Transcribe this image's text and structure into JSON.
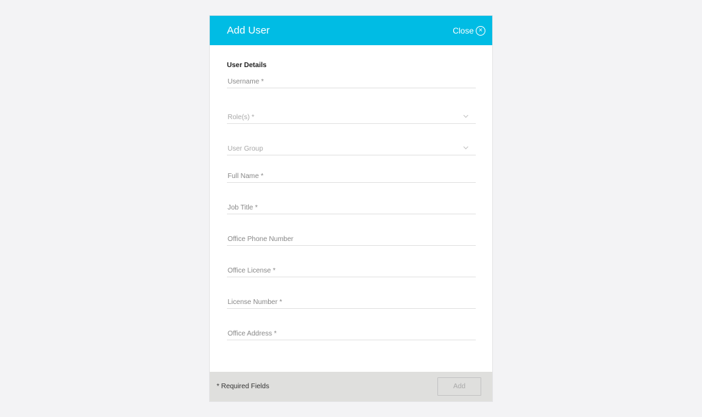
{
  "dialog": {
    "title": "Add User",
    "close_label": "Close",
    "close_icon": "circle-x-icon",
    "accent_color": "#00bce4"
  },
  "form": {
    "section_title": "User Details",
    "fields": [
      {
        "name": "username",
        "placeholder": "Username *",
        "type": "text",
        "value": ""
      },
      {
        "name": "roles",
        "placeholder": "Role(s) *",
        "type": "select",
        "value": ""
      },
      {
        "name": "user-group",
        "placeholder": "User Group",
        "type": "select",
        "value": ""
      },
      {
        "name": "full-name",
        "placeholder": "Full Name *",
        "type": "text",
        "value": ""
      },
      {
        "name": "job-title",
        "placeholder": "Job Title *",
        "type": "text",
        "value": ""
      },
      {
        "name": "office-phone-number",
        "placeholder": "Office Phone Number",
        "type": "text",
        "value": ""
      },
      {
        "name": "office-license",
        "placeholder": "Office License *",
        "type": "text",
        "value": ""
      },
      {
        "name": "license-number",
        "placeholder": "License Number *",
        "type": "text",
        "value": ""
      },
      {
        "name": "office-address",
        "placeholder": "Office Address *",
        "type": "text",
        "value": ""
      }
    ]
  },
  "footer": {
    "required_note": "* Required Fields",
    "add_label": "Add"
  }
}
